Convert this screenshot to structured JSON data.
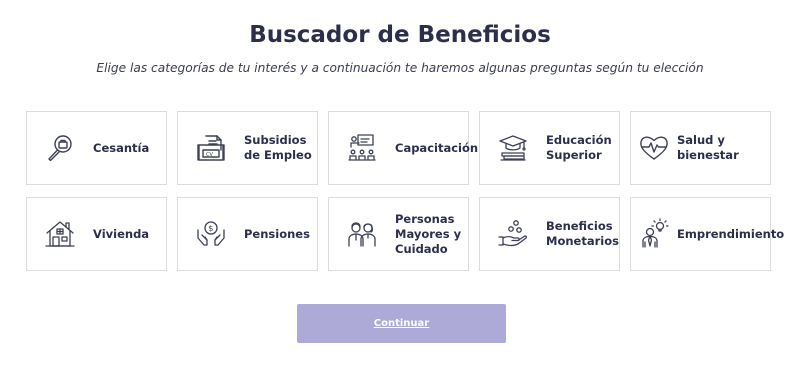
{
  "page": {
    "title": "Buscador de Beneficios",
    "subtitle": "Elige las categorías de tu interés y a continuación te haremos algunas preguntas según tu elección"
  },
  "categories": [
    {
      "label": "Cesantía",
      "icon": "magnifier-briefcase-icon"
    },
    {
      "label": "Subsidios de Empleo",
      "icon": "subsidy-document-icon"
    },
    {
      "label": "Capacitación",
      "icon": "training-classroom-icon"
    },
    {
      "label": "Educación Superior",
      "icon": "graduation-cap-icon"
    },
    {
      "label": "Salud y bienestar",
      "icon": "heart-pulse-icon"
    },
    {
      "label": "Vivienda",
      "icon": "house-icon"
    },
    {
      "label": "Pensiones",
      "icon": "hands-coin-icon"
    },
    {
      "label": "Personas Mayores y Cuidado",
      "icon": "elderly-couple-icon"
    },
    {
      "label": "Beneficios Monetarios",
      "icon": "hand-coins-icon"
    },
    {
      "label": "Emprendimiento",
      "icon": "entrepreneur-idea-icon"
    }
  ],
  "actions": {
    "continue_label": "Continuar"
  },
  "colors": {
    "text": "#2b2f4a",
    "icon_stroke": "#3d4055",
    "button_bg": "#aeaad8",
    "card_border": "#dcdcdc"
  }
}
